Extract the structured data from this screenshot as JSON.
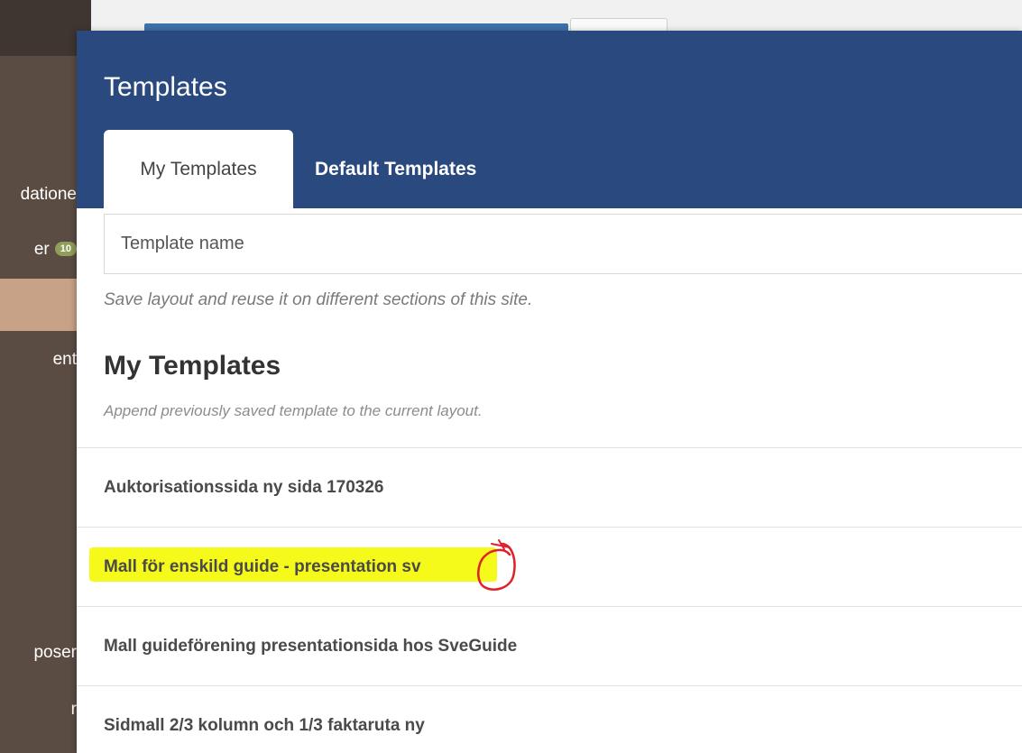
{
  "sidebar": {
    "items": [
      {
        "label": "datione"
      },
      {
        "label": "er",
        "badge": "10"
      },
      {
        "label": "ent"
      },
      {
        "label": "poser"
      },
      {
        "label": "r"
      }
    ]
  },
  "modal": {
    "title": "Templates",
    "tabs": [
      {
        "label": "My Templates",
        "active": true
      },
      {
        "label": "Default Templates",
        "active": false
      }
    ],
    "name_input": {
      "placeholder": "Template name",
      "value": ""
    },
    "save_hint": "Save layout and reuse it on different sections of this site.",
    "section_title": "My Templates",
    "section_subtitle": "Append previously saved template to the current layout.",
    "templates": [
      {
        "name": "Auktorisationssida ny sida 170326"
      },
      {
        "name": "Mall för enskild guide - presentation sv",
        "highlighted": true
      },
      {
        "name": "Mall guideförening presentationsida hos SveGuide"
      },
      {
        "name": "Sidmall 2/3 kolumn och 1/3 faktaruta ny"
      }
    ]
  },
  "colors": {
    "header": "#2a4a7f",
    "sidebar": "#5b4c43",
    "highlight": "#f6fa1a",
    "annotation": "#e0202a"
  }
}
